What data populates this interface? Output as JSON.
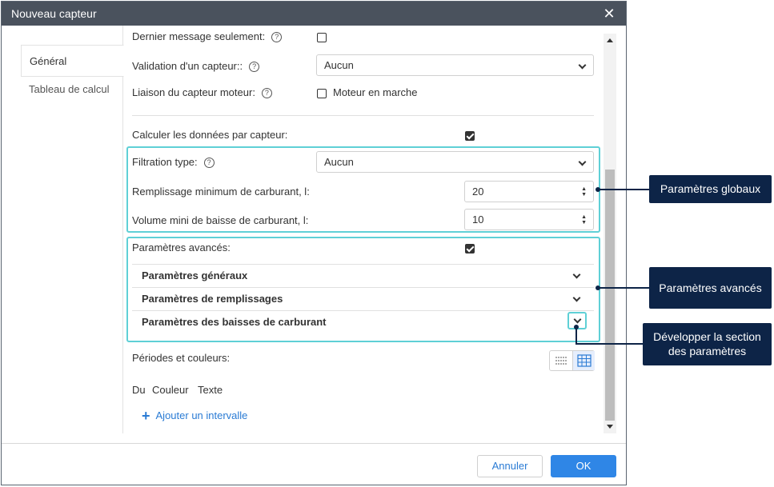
{
  "dialog": {
    "title": "Nouveau capteur",
    "close_icon": "close-icon"
  },
  "tabs": [
    {
      "label": "Général",
      "active": true
    },
    {
      "label": "Tableau de calcul",
      "active": false
    }
  ],
  "form": {
    "last_message_label": "Dernier message seulement:",
    "validation_label": "Validation d'un capteur::",
    "validation_value": "Aucun",
    "engine_link_label": "Liaison du capteur moteur:",
    "engine_on_label": "Moteur en marche",
    "calc_per_sensor_label": "Calculer les données par capteur:",
    "filtration_label": "Filtration type:",
    "filtration_value": "Aucun",
    "min_fill_label": "Remplissage minimum de carburant, l:",
    "min_fill_value": "20",
    "min_drain_label": "Volume mini de baisse de carburant, l:",
    "min_drain_value": "10",
    "advanced_label": "Paramètres avancés:",
    "sections": [
      "Paramètres généraux",
      "Paramètres de remplissages",
      "Paramètres des baisses de carburant"
    ],
    "periods_label": "Périodes et couleurs:",
    "col_from": "Du",
    "col_color": "Couleur",
    "col_text": "Texte",
    "add_interval": "Ajouter un intervalle"
  },
  "footer": {
    "cancel": "Annuler",
    "ok": "OK"
  },
  "callouts": {
    "global": "Paramètres globaux",
    "advanced": "Paramètres avancés",
    "expand_line1": "Développer la section",
    "expand_line2": "des paramètres"
  },
  "colors": {
    "titlebar": "#4a525d",
    "highlight": "#5fd0d6",
    "callout": "#0d2447",
    "link": "#2a7bd4",
    "primary": "#2f86e6"
  }
}
